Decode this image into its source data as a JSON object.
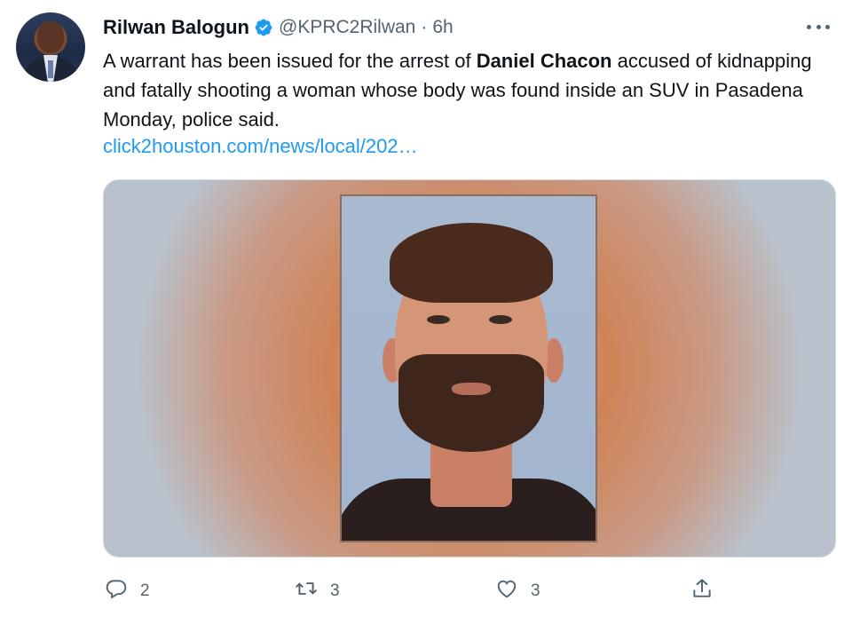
{
  "tweet": {
    "display_name": "Rilwan Balogun",
    "verified_icon": "verified-badge-icon",
    "handle": "@KPRC2Rilwan",
    "separator": "·",
    "time": "6h",
    "text_before": "A warrant has been issued for the arrest of ",
    "text_bold": "Daniel Chacon",
    "text_after": " accused of kidnapping and fatally shooting a woman whose body was found inside an SUV in Pasadena Monday, police said.",
    "link": "click2houston.com/news/local/202…"
  },
  "actions": {
    "reply_count": "2",
    "retweet_count": "3",
    "like_count": "3"
  },
  "colors": {
    "accent": "#1d9bf0",
    "secondary_text": "#536471",
    "primary_text": "#0f1419"
  }
}
